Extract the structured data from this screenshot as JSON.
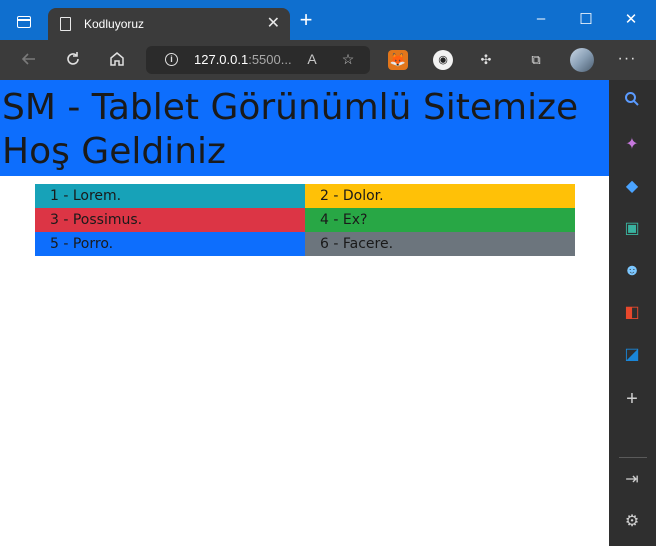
{
  "browser": {
    "tab_title": "Kodluyoruz",
    "tab_close": "✕",
    "new_tab": "+",
    "url_host": "127.0.0.1",
    "url_rest": ":5500...",
    "window_controls": {
      "minimize": "–",
      "maximize": "☐",
      "close": "✕"
    }
  },
  "icons": {
    "back": "arrow-left-icon",
    "refresh": "refresh-icon",
    "home": "home-icon",
    "info": "info-icon",
    "read_aloud": "read-aloud-icon",
    "favorite": "add-favorite-icon",
    "fox": "metamask-extension-icon",
    "ghost": "ghost-extension-icon",
    "puzzle": "extensions-icon",
    "collections": "collections-icon",
    "profile": "profile-avatar",
    "more": "more-icon"
  },
  "sidebar": {
    "items": [
      {
        "name": "search",
        "glyph": "⚲",
        "color": "#5b9bff"
      },
      {
        "name": "copilot",
        "glyph": "✦",
        "color": "#c678dd"
      },
      {
        "name": "shopping",
        "glyph": "◆",
        "color": "#4aa3ff"
      },
      {
        "name": "tools",
        "glyph": "▣",
        "color": "#39b3a0"
      },
      {
        "name": "games",
        "glyph": "☻",
        "color": "#7cc7ff"
      },
      {
        "name": "office",
        "glyph": "◧",
        "color": "#e8482c"
      },
      {
        "name": "outlook",
        "glyph": "◪",
        "color": "#1a86d8"
      },
      {
        "name": "add",
        "glyph": "+",
        "color": "#d0d0d0"
      }
    ],
    "bottom": [
      {
        "name": "hide-sidebar",
        "glyph": "⇥",
        "color": "#d0d0d0"
      },
      {
        "name": "settings",
        "glyph": "⚙",
        "color": "#d0d0d0"
      }
    ]
  },
  "page": {
    "heading": "SM - Tablet Görünümlü Sitemize Hoş Geldiniz",
    "colors": {
      "hero": "#0d6efd"
    },
    "grid": [
      {
        "text": "1 - Lorem.",
        "color": "#17a2b8"
      },
      {
        "text": "2 - Dolor.",
        "color": "#ffc107"
      },
      {
        "text": "3 - Possimus.",
        "color": "#dc3545"
      },
      {
        "text": "4 - Ex?",
        "color": "#28a745"
      },
      {
        "text": "5 - Porro.",
        "color": "#0d6efd"
      },
      {
        "text": "6 - Facere.",
        "color": "#6c757d"
      }
    ]
  }
}
